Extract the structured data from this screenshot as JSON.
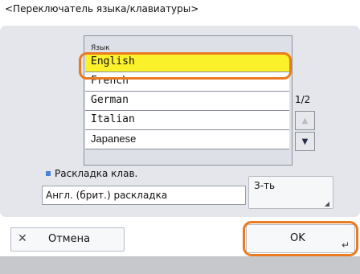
{
  "screen": {
    "title": "<Переключатель языка/клавиатуры>"
  },
  "language": {
    "header": "Язык",
    "items": [
      {
        "label": "English"
      },
      {
        "label": "French"
      },
      {
        "label": "German"
      },
      {
        "label": "Italian"
      },
      {
        "label": "Japanese"
      }
    ],
    "selected": "English",
    "page_indicator": "1/2",
    "scroll_up_icon": "triangle-up",
    "scroll_down_icon": "triangle-down"
  },
  "keyboard": {
    "label": "Раскладка клав.",
    "value": "Англ. (брит.) раскладка",
    "change_button": "З-ть"
  },
  "footer": {
    "cancel_label": "Отмена",
    "ok_label": "OK"
  },
  "colors": {
    "selected_bg": "#fbf12a",
    "highlight_ring": "#ea7b22",
    "panel_bg": "#e4e6ec",
    "bullet": "#4a83d4"
  }
}
